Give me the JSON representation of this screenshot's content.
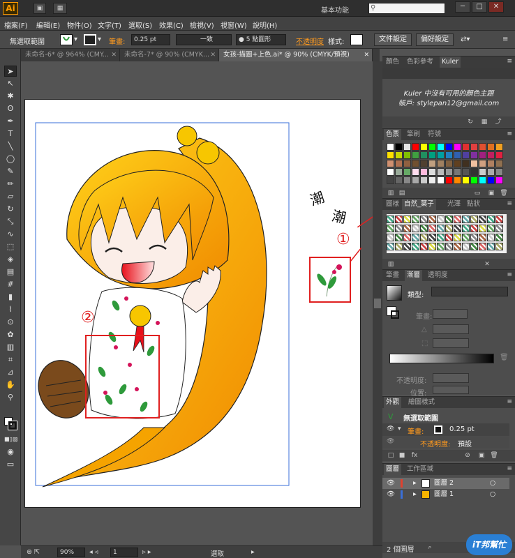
{
  "app": {
    "logo": "Ai",
    "workspace": "基本功能",
    "window_buttons": [
      "─",
      "□",
      "✕"
    ]
  },
  "menu": [
    "檔案(F)",
    "編輯(E)",
    "物件(O)",
    "文字(T)",
    "選取(S)",
    "效果(C)",
    "檢視(V)",
    "視窗(W)",
    "說明(H)"
  ],
  "control": {
    "selection": "無選取範圍",
    "stroke_label": "筆畫:",
    "stroke_value": "0.25 pt",
    "line_style": "一致",
    "brush": "● 5 點圓形",
    "opacity_label": "不透明度",
    "style_label": "樣式:",
    "doc_settings": "文件設定",
    "prefs": "偏好設定"
  },
  "tabs": [
    {
      "label": "未命名-6* @ 964% (CMY..."
    },
    {
      "label": "未命名-7* @ 90% (CMYK..."
    },
    {
      "label": "女孩-描圖+上色.ai* @ 90% (CMYK/預視)"
    }
  ],
  "canvas": {
    "handwriting_1": "潮",
    "handwriting_2": "潮",
    "callout_1": "①",
    "callout_2": "②"
  },
  "panels": {
    "color_tabs": [
      "顏色",
      "色彩參考",
      "Kuler"
    ],
    "kuler_line1": "Kuler 中沒有可用的顏色主題",
    "kuler_line2": "帳戶: stylepan12@gmail.com",
    "swatch_tabs": [
      "色票",
      "筆刷",
      "符號"
    ],
    "pattern_tabs": [
      "圖樣",
      "自然_葉子",
      "光澤",
      "點狀"
    ],
    "gradient_tabs": [
      "筆畫",
      "漸層",
      "透明度"
    ],
    "gradient_type_label": "類型:",
    "gradient_stroke_label": "筆畫:",
    "gradient_opacity_label": "不透明度:",
    "gradient_position_label": "位置:",
    "appearance_tabs": [
      "外觀",
      "繪圖樣式"
    ],
    "appearance_title": "無選取範圍",
    "appearance_stroke_label": "筆畫:",
    "appearance_stroke_value": "0.25 pt",
    "appearance_opacity_label": "不透明度:",
    "appearance_opacity_value": "預設",
    "layer_tabs": [
      "圖層",
      "工作區域"
    ],
    "layers": [
      {
        "name": "圖層 2",
        "color": "#e0412f"
      },
      {
        "name": "圖層 1",
        "color": "#3a6fd8"
      }
    ],
    "layer_count": "2 個圖層"
  },
  "status": {
    "zoom": "90%",
    "page": "1",
    "tool": "選取"
  },
  "watermark": "iT邦幫忙",
  "colors": {
    "accent": "#ff9a1e",
    "annotation_red": "#e02020",
    "hair": "#f7b400",
    "leaf": "#2e9a3b",
    "berry": "#d4145a"
  }
}
